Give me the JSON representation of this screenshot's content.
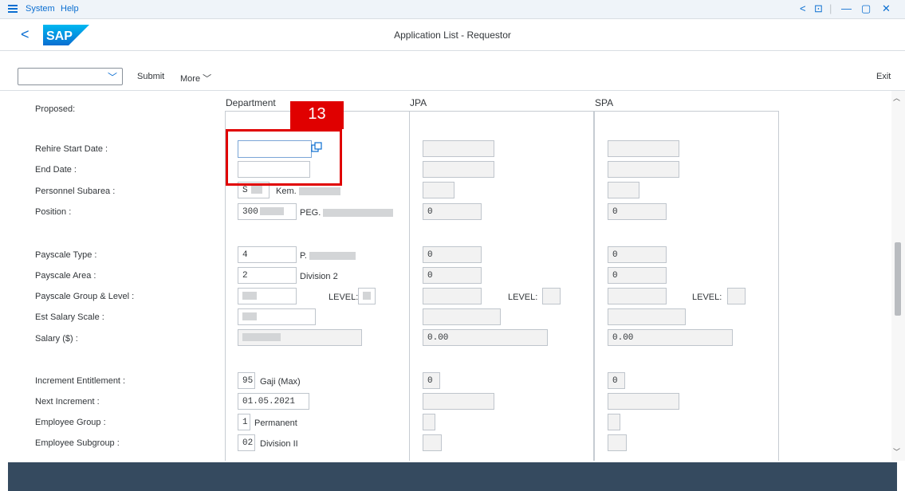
{
  "menu": {
    "system": "System",
    "help": "Help"
  },
  "window_controls": {
    "back": "<",
    "lock": "⊡",
    "minimize": "—",
    "maximize": "▢",
    "close": "✕"
  },
  "header": {
    "back": "<",
    "logo_text": "SAP",
    "title": "Application List - Requestor"
  },
  "toolbar": {
    "command_value": "",
    "submit": "Submit",
    "more": "More",
    "exit": "Exit"
  },
  "columns": {
    "department": "Department",
    "jpa": "JPA",
    "spa": "SPA"
  },
  "labels": {
    "proposed": "Proposed:",
    "rehire_start": "Rehire Start Date :",
    "end_date": "End Date :",
    "personnel_subarea": "Personnel Subarea :",
    "position": "Position :",
    "payscale_type": "Payscale Type :",
    "payscale_area": "Payscale Area :",
    "payscale_group": "Payscale Group & Level :",
    "est_salary": "Est Salary Scale :",
    "salary": "Salary ($) :",
    "increment": "Increment Entitlement :",
    "next_increment": "Next Increment :",
    "employee_group": "Employee Group :",
    "employee_subgroup": "Employee Subgroup :"
  },
  "department": {
    "subarea_code": "S",
    "subarea_text": "Kem.",
    "position_code": "300",
    "position_text": "PEG.",
    "payscale_type": "4",
    "payscale_type_text": "P.",
    "payscale_area": "2",
    "payscale_area_text": "Division 2",
    "level_label": "LEVEL:",
    "increment": "95",
    "increment_text": "Gaji (Max)",
    "next_increment": "01.05.2021",
    "employee_group": "1",
    "employee_group_text": "Permanent",
    "employee_subgroup": "02",
    "employee_subgroup_text": "Division II"
  },
  "jpa": {
    "position": "0",
    "payscale_type": "0",
    "payscale_area": "0",
    "level_label": "LEVEL:",
    "salary": "0.00",
    "increment": "0"
  },
  "spa": {
    "position": "0",
    "payscale_type": "0",
    "payscale_area": "0",
    "level_label": "LEVEL:",
    "salary": "0.00",
    "increment": "0"
  },
  "annotation": {
    "step": "13"
  },
  "colors": {
    "accent": "#0a6ed1",
    "annotation": "#e00000",
    "status_bar": "#354a5f"
  }
}
